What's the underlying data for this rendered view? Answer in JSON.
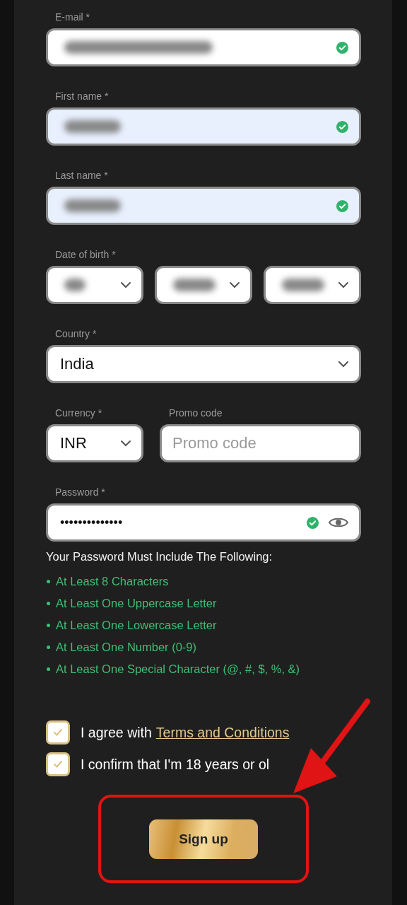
{
  "email": {
    "label": "E-mail *",
    "valid": true,
    "autofilled": false
  },
  "first_name": {
    "label": "First name *",
    "valid": true,
    "autofilled": true
  },
  "last_name": {
    "label": "Last name *",
    "valid": true,
    "autofilled": true
  },
  "date_of_birth": {
    "label": "Date of birth *"
  },
  "country": {
    "label": "Country *",
    "value": "India"
  },
  "currency": {
    "label": "Currency *",
    "value": "INR"
  },
  "promo_code": {
    "label": "Promo code",
    "placeholder": "Promo code"
  },
  "password": {
    "label": "Password *",
    "value": "••••••••••••••",
    "valid": true
  },
  "password_rules": {
    "title": "Your Password Must Include The Following:",
    "items": [
      {
        "text": "At Least 8 Characters",
        "met": true
      },
      {
        "text": "At Least One Uppercase Letter",
        "met": true
      },
      {
        "text": "At Least One Lowercase Letter",
        "met": true
      },
      {
        "text": "At Least One Number (0-9)",
        "met": true
      },
      {
        "text": "At Least One Special Character (@, #, $, %, &)",
        "met": true
      }
    ]
  },
  "agreements": [
    {
      "text": "I agree with",
      "link": "Terms and Conditions",
      "checked": true
    },
    {
      "text": "I confirm that I'm 18 years or ol",
      "checked": true
    }
  ],
  "submit": {
    "label": "Sign up"
  }
}
